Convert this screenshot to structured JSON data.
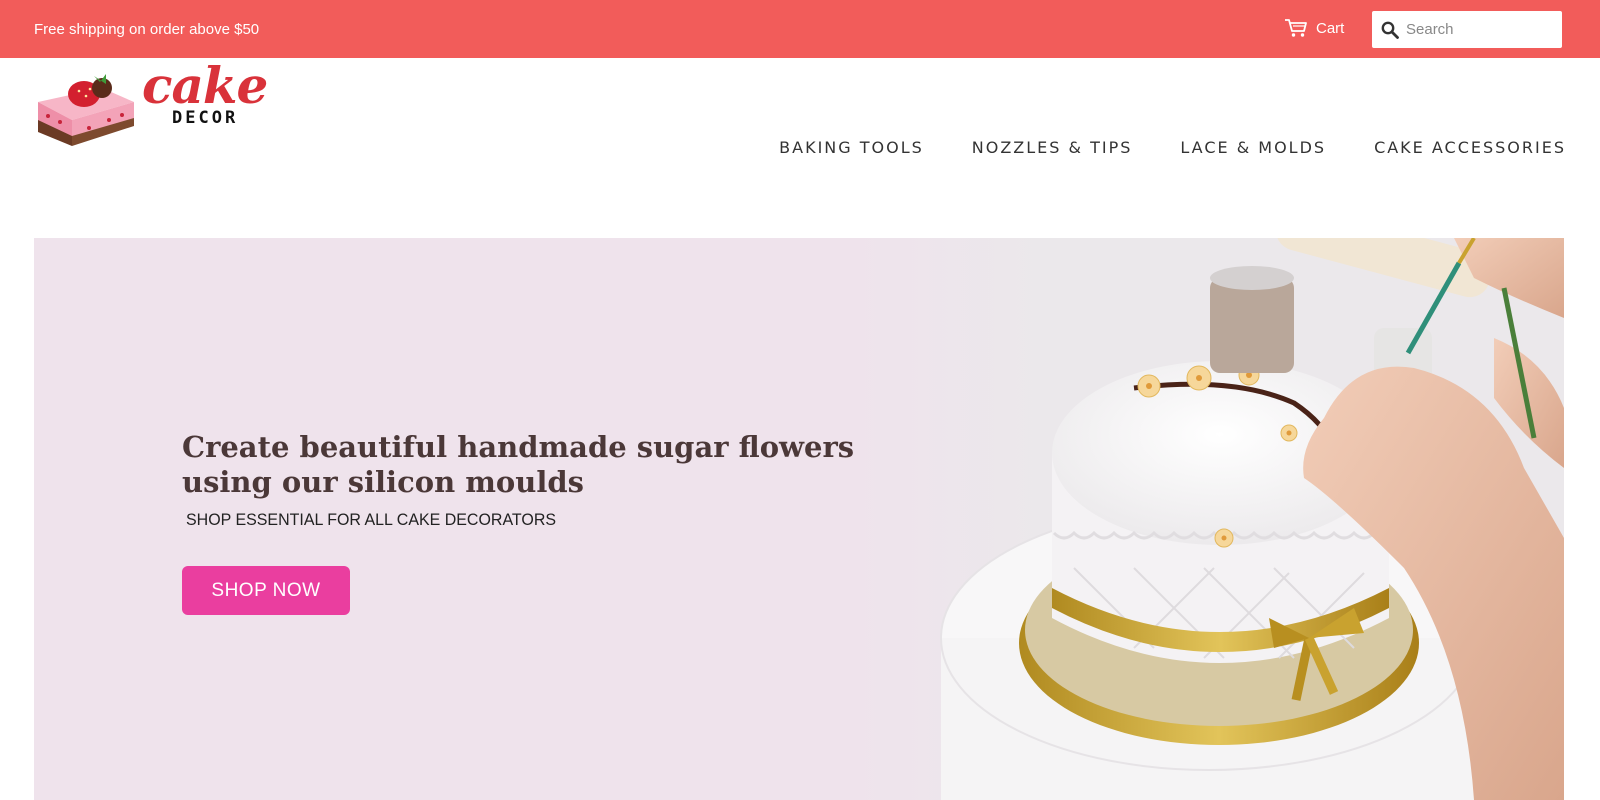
{
  "topbar": {
    "promo_text": "Free shipping on order above $50",
    "cart_label": "Cart",
    "search_placeholder": "Search",
    "background_color": "#f25c5a"
  },
  "logo": {
    "word_top": "cake",
    "word_bottom": "DECOR",
    "icon": "cake-slice-icon"
  },
  "nav": {
    "items": [
      {
        "label": "BAKING TOOLS"
      },
      {
        "label": "NOZZLES & TIPS"
      },
      {
        "label": "LACE & MOLDS"
      },
      {
        "label": "CAKE ACCESSORIES"
      }
    ]
  },
  "hero": {
    "title_line1": "Create beautiful handmade sugar flowers",
    "title_line2": "using our silicon moulds",
    "subtitle": "SHOP ESSENTIAL FOR ALL CAKE DECORATORS",
    "button_label": "SHOP NOW",
    "background_color": "#efe3ec",
    "button_color": "#ea3e9f",
    "image": "decorated-cake-photo"
  }
}
